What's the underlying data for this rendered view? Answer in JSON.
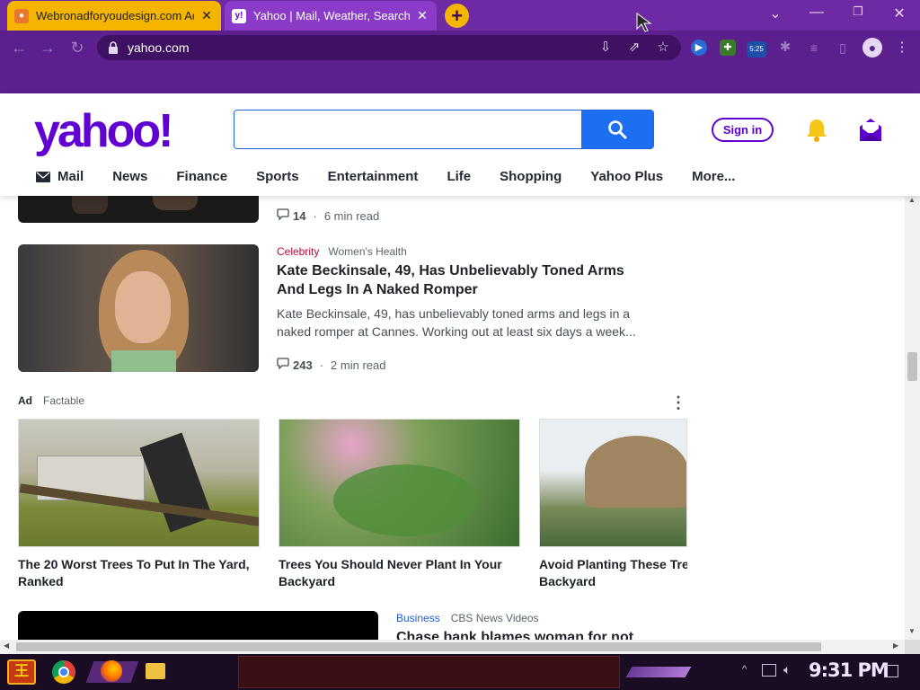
{
  "browser": {
    "tabs": [
      {
        "title": "Webronadforyoudesign.com Ad",
        "active": false
      },
      {
        "title": "Yahoo | Mail, Weather, Search",
        "active": true
      }
    ],
    "url": "yahoo.com",
    "ext_badge": "5:25"
  },
  "yahoo": {
    "logo": "yahoo!",
    "search_placeholder": "",
    "signin": "Sign in",
    "nav": [
      "Mail",
      "News",
      "Finance",
      "Sports",
      "Entertainment",
      "Life",
      "Shopping",
      "Yahoo Plus",
      "More..."
    ]
  },
  "stories": {
    "prev_meta": {
      "comments": "14",
      "read_time": "6 min read"
    },
    "story2": {
      "categories": [
        "Celebrity",
        "Women's Health"
      ],
      "headline": "Kate Beckinsale, 49, Has Unbelievably Toned Arms And Legs In A Naked Romper",
      "summary": "Kate Beckinsale, 49, has unbelievably toned arms and legs in a naked romper at Cannes. Working out at least six days a week...",
      "comments": "243",
      "read_time": "2 min read"
    },
    "ad": {
      "label": "Ad",
      "sponsor": "Factable",
      "cards": [
        {
          "title_line1": "The 20 Worst Trees To Put In The Yard,",
          "title_line2": "Ranked"
        },
        {
          "title_line1": "Trees You Should Never Plant In Your",
          "title_line2": "Backyard"
        },
        {
          "title_line1": "Avoid Planting These Trees",
          "title_line2": "Backyard"
        }
      ]
    },
    "story3": {
      "categories": [
        "Business",
        "CBS News Videos"
      ],
      "headline": "Chase bank blames woman for not"
    }
  },
  "taskbar": {
    "time": "9:31 PM"
  }
}
